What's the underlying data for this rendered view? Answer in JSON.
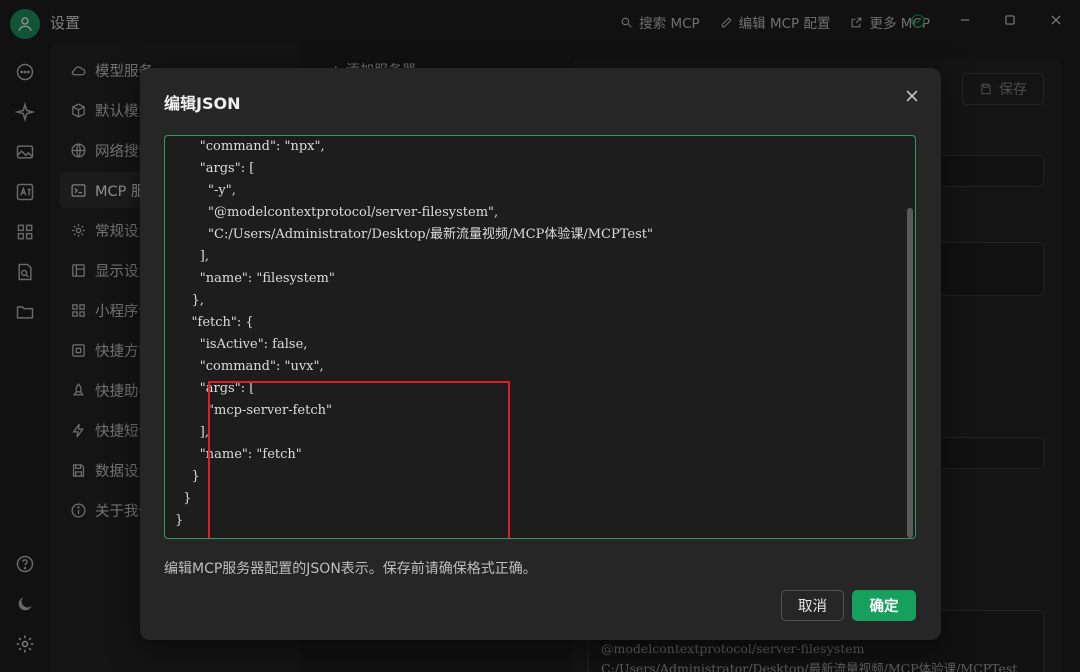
{
  "window": {
    "title": "设置",
    "actions": [
      {
        "label": "搜索 MCP",
        "icon": "search-icon"
      },
      {
        "label": "编辑 MCP 配置",
        "icon": "pencil-icon"
      },
      {
        "label": "更多 MCP",
        "icon": "external-link-icon"
      }
    ]
  },
  "menu": {
    "items": [
      {
        "label": "模型服务",
        "icon": "cloud-icon"
      },
      {
        "label": "默认模型",
        "icon": "cube-icon"
      },
      {
        "label": "网络搜索",
        "icon": "globe-icon"
      },
      {
        "label": "MCP 服务器",
        "icon": "terminal-icon",
        "active": true
      },
      {
        "label": "常规设置",
        "icon": "gear-icon"
      },
      {
        "label": "显示设置",
        "icon": "layout-icon"
      },
      {
        "label": "小程序设置",
        "icon": "grid-icon"
      },
      {
        "label": "快捷方式",
        "icon": "command-icon"
      },
      {
        "label": "快捷助手",
        "icon": "rocket-icon"
      },
      {
        "label": "快捷短语",
        "icon": "zap-icon"
      },
      {
        "label": "数据设置",
        "icon": "save-icon"
      },
      {
        "label": "关于我们",
        "icon": "info-icon"
      }
    ],
    "mid_label": "+ 添加服务器"
  },
  "right_panel": {
    "save_label": "保存",
    "code_lines": [
      "@modelcontextprotocol/server-filesystem",
      "C:/Users/Administrator/Desktop/最新流量视频/MCP体验课/MCPTest"
    ]
  },
  "dialog": {
    "title": "编辑JSON",
    "code_lines": [
      "      \"command\": \"npx\",",
      "      \"args\": [",
      "        \"-y\",",
      "        \"@modelcontextprotocol/server-filesystem\",",
      "        \"C:/Users/Administrator/Desktop/最新流量视频/MCP体验课/MCPTest\"",
      "      ],",
      "      \"name\": \"filesystem\"",
      "    },",
      "    \"fetch\": {",
      "      \"isActive\": false,",
      "      \"command\": \"uvx\",",
      "      \"args\": [",
      "        \"mcp-server-fetch\"",
      "      ],",
      "      \"name\": \"fetch\"",
      "    }",
      "  }",
      "}"
    ],
    "hint": "编辑MCP服务器配置的JSON表示。保存前请确保格式正确。",
    "cancel_label": "取消",
    "ok_label": "确定"
  },
  "colors": {
    "accent": "#17a05d",
    "editor_border": "#2f9a68",
    "highlight": "#e02020"
  }
}
